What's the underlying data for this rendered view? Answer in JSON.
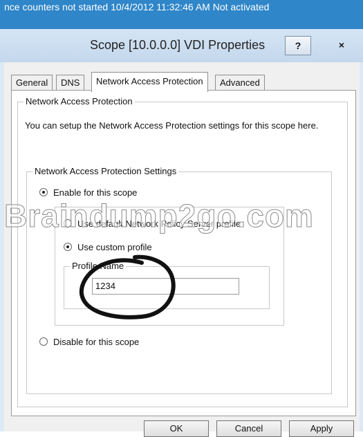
{
  "taskbar": {
    "status_text": "nce counters not started   10/4/2012 11:32:46 AM   Not activated"
  },
  "dialog": {
    "title": "Scope [10.0.0.0] VDI Properties",
    "help_label": "?",
    "close_label": "×",
    "tabs": [
      {
        "label": "General"
      },
      {
        "label": "DNS"
      },
      {
        "label": "Network Access Protection"
      },
      {
        "label": "Advanced"
      }
    ],
    "active_tab": "Network Access Protection",
    "nap_group": {
      "legend": "Network Access Protection",
      "description": "You can setup the Network Access Protection settings for this scope here.",
      "settings_group": {
        "legend": "Network Access Protection Settings",
        "enable_label": "Enable for this scope",
        "default_profile_label": "Use default Network Policy Server profile",
        "custom_profile_label": "Use custom profile",
        "profile_name_legend": "Profile Name",
        "profile_name_value": "1234",
        "disable_label": "Disable for this scope"
      }
    },
    "buttons": {
      "ok": "OK",
      "cancel": "Cancel",
      "apply": "Apply"
    }
  },
  "watermark": "Braindump2go.com",
  "colors": {
    "taskbar": "#2f86c9",
    "titlebar": "#c4d7ec",
    "dialog_bg": "#f0f0f0"
  }
}
